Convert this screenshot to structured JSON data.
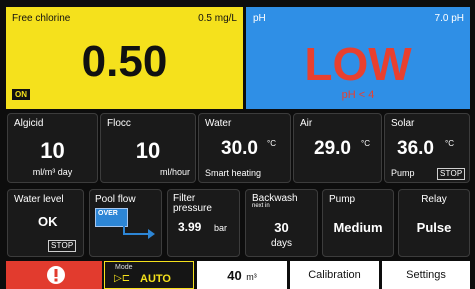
{
  "chlorine": {
    "label": "Free chlorine",
    "setpoint": "0.5 mg/L",
    "value": "0.50",
    "state": "ON"
  },
  "ph": {
    "label": "pH",
    "setpoint": "7.0 pH",
    "value": "LOW",
    "note": "pH < 4"
  },
  "algicid": {
    "label": "Algicid",
    "value": "10",
    "unit": "ml/m³ day"
  },
  "flocc": {
    "label": "Flocc",
    "value": "10",
    "unit": "ml/hour"
  },
  "water": {
    "label": "Water",
    "value": "30.0",
    "unit": "°C",
    "mode": "Smart heating"
  },
  "air": {
    "label": "Air",
    "value": "29.0",
    "unit": "°C"
  },
  "solar": {
    "label": "Solar",
    "value": "36.0",
    "unit": "°C",
    "sub": "Pump",
    "stop": "STOP"
  },
  "water_level": {
    "label": "Water level",
    "value": "OK",
    "stop": "STOP"
  },
  "pool_flow": {
    "label": "Pool flow",
    "badge": "OVER"
  },
  "filter": {
    "label_line1": "Filter",
    "label_line2": "pressure",
    "value": "3.99",
    "unit": "bar"
  },
  "backwash": {
    "label": "Backwash",
    "sub": "next in",
    "value": "30",
    "unit": "days"
  },
  "pump": {
    "label": "Pump",
    "value": "Medium"
  },
  "relay": {
    "label": "Relay",
    "value": "Pulse"
  },
  "bottom": {
    "alarm_icon": "exclamation-icon",
    "mode_label": "Mode",
    "mode_value": "AUTO",
    "mode_icon": "▷⊏",
    "volume_value": "40",
    "volume_unit": "m³",
    "calibration": "Calibration",
    "settings": "Settings"
  },
  "colors": {
    "yellow": "#f5e11c",
    "blue": "#2f8fe6",
    "red": "#e23b2e",
    "flow_blue": "#2d86d6"
  }
}
